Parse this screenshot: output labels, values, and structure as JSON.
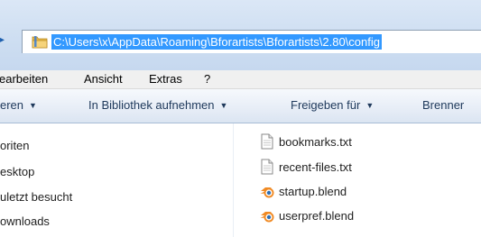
{
  "address": {
    "path": "C:\\Users\\x\\AppData\\Roaming\\Bforartists\\Bforartists\\2.80\\config"
  },
  "menu": {
    "items": [
      "earbeiten",
      "Ansicht",
      "Extras",
      "?"
    ]
  },
  "toolbar": {
    "organize": "eren",
    "library": "In Bibliothek aufnehmen",
    "share": "Freigeben für",
    "burn": "Brenner"
  },
  "nav": {
    "items": [
      "oriten",
      "esktop",
      "uletzt besucht",
      "ownloads"
    ]
  },
  "files": [
    {
      "name": "bookmarks.txt",
      "icon": "text-file-icon"
    },
    {
      "name": "recent-files.txt",
      "icon": "text-file-icon"
    },
    {
      "name": "startup.blend",
      "icon": "blend-file-icon"
    },
    {
      "name": "userpref.blend",
      "icon": "blend-file-icon"
    }
  ],
  "colors": {
    "selection": "#3399ff",
    "toolbar_text": "#1e395b",
    "blend_orange": "#f08a24",
    "blend_blue": "#2f6fb3"
  }
}
